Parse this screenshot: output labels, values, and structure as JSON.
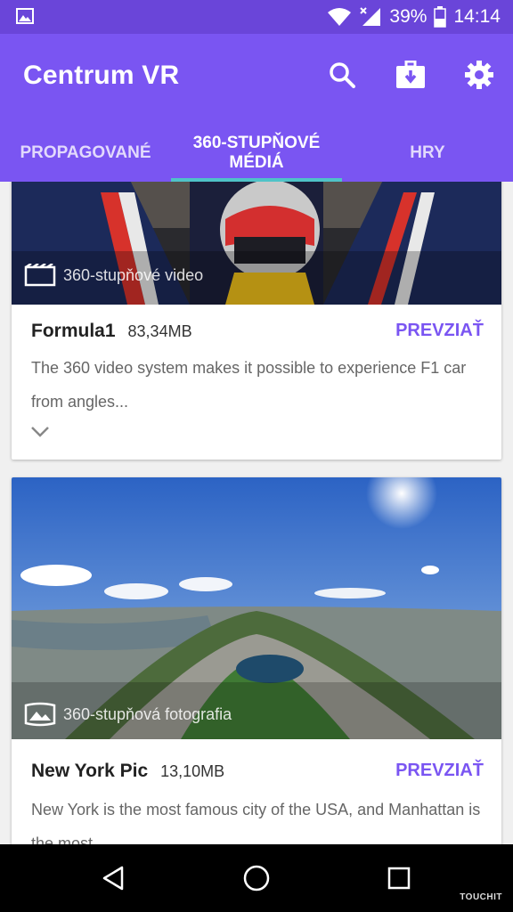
{
  "status": {
    "battery": "39%",
    "time": "14:14"
  },
  "app": {
    "title": "Centrum VR"
  },
  "tabs": [
    {
      "label": "PROPAGOVANÉ"
    },
    {
      "label": "360-STUPŇOVÉ\nMÉDIÁ"
    },
    {
      "label": "HRY"
    }
  ],
  "cards": [
    {
      "media_label": "360-stupňové video",
      "title": "Formula1",
      "size": "83,34MB",
      "action": "PREVZIAŤ",
      "description": "The 360 video system makes it possible to experience F1 car from angles..."
    },
    {
      "media_label": "360-stupňová fotografia",
      "title": "New York Pic",
      "size": "13,10MB",
      "action": "PREVZIAŤ",
      "description": "New York is the most famous city of the USA, and Manhattan is the most..."
    }
  ],
  "watermark": "TOUCHIT",
  "colors": {
    "primary": "#7a55f2",
    "status_bar": "#6a45d9",
    "tab_indicator": "#4fc3c8"
  }
}
